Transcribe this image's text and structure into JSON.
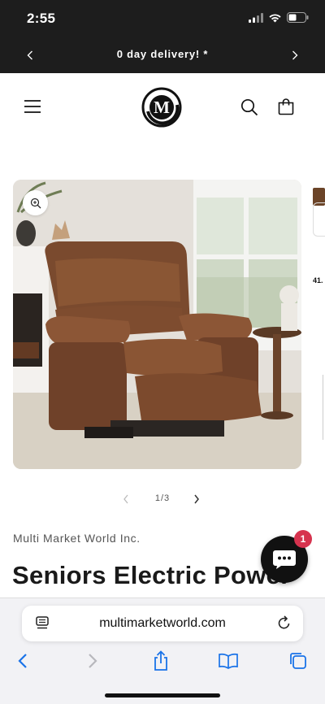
{
  "status_bar": {
    "time": "2:55"
  },
  "announcement": {
    "text": "0 day delivery! *"
  },
  "header": {
    "logo_letter": "M"
  },
  "product": {
    "vendor": "Multi Market World Inc.",
    "title": "Seniors Electric Power",
    "gallery_pager": "1/3",
    "peek_price_fragment": "41."
  },
  "chat": {
    "badge_count": "1",
    "icon": "chat-bubble-icon"
  },
  "browser": {
    "url": "multimarketworld.com"
  },
  "colors": {
    "dark_bar": "#1d1d1d",
    "badge": "#d6334e",
    "link_blue": "#1a73e8"
  }
}
